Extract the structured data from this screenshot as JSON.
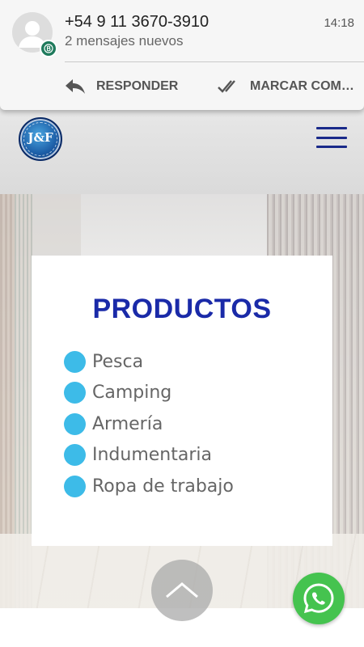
{
  "notification": {
    "title": "+54 9 11 3670-3910",
    "time": "14:18",
    "subtitle": "2 mensajes nuevos",
    "actions": [
      {
        "label": "RESPONDER",
        "icon": "reply-icon"
      },
      {
        "label": "MARCAR COM…",
        "icon": "double-check-icon"
      }
    ],
    "app_icon": "whatsapp-business-badge-icon"
  },
  "header": {
    "logo_text": "J&F",
    "menu_icon": "hamburger-menu-icon"
  },
  "products": {
    "title": "PRODUCTOS",
    "items": [
      "Pesca",
      "Camping",
      "Armería",
      "Indumentaria",
      "Ropa de trabajo"
    ],
    "bullet_color": "#3dbbe8",
    "title_color": "#1a2aa8"
  },
  "floating": {
    "scroll_top_icon": "chevron-up-icon",
    "whatsapp_icon": "whatsapp-icon",
    "whatsapp_color": "#45c34f"
  }
}
